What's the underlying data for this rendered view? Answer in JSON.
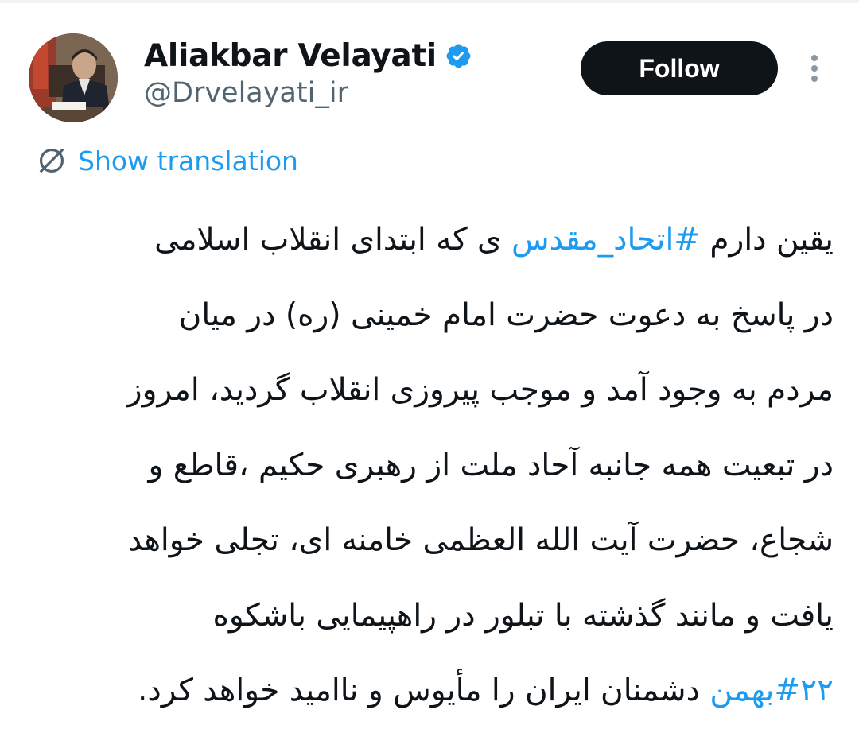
{
  "author": {
    "display_name": "Aliakbar Velayati",
    "handle": "@Drvelayati_ir",
    "verified": true,
    "avatar": "profile-photo"
  },
  "actions": {
    "follow_label": "Follow",
    "more_icon": "vertical-ellipsis-icon"
  },
  "translation": {
    "label": "Show translation",
    "icon": "globe-slash-icon"
  },
  "tweet": {
    "line1": {
      "before": "یقین دارم ",
      "hashtag": "#اتحاد_مقدس",
      "after": " ی که ابتدای انقلاب اسلامی"
    },
    "line2": "در پاسخ به دعوت حضرت امام خمینی (ره) در میان",
    "line3": "مردم به وجود آمد و موجب پیروزی انقلاب گردید، امروز",
    "line4": "در تبعیت همه جانبه آحاد ملت از رهبری حکیم ،قاطع و",
    "line5": "شجاع، حضرت آیت الله العظمی خامنه ای، تجلی خواهد",
    "line6": "یافت و مانند گذشته با تبلور در راهپیمایی باشکوه",
    "line7": {
      "hashtag": "#۲۲بهمن",
      "after": " دشمنان ایران را مأیوس و ناامید خواهد کرد."
    }
  },
  "colors": {
    "text": "#0f1419",
    "secondary": "#536471",
    "link": "#1d9bf0",
    "follow_bg": "#0f1419",
    "follow_text": "#ffffff"
  }
}
